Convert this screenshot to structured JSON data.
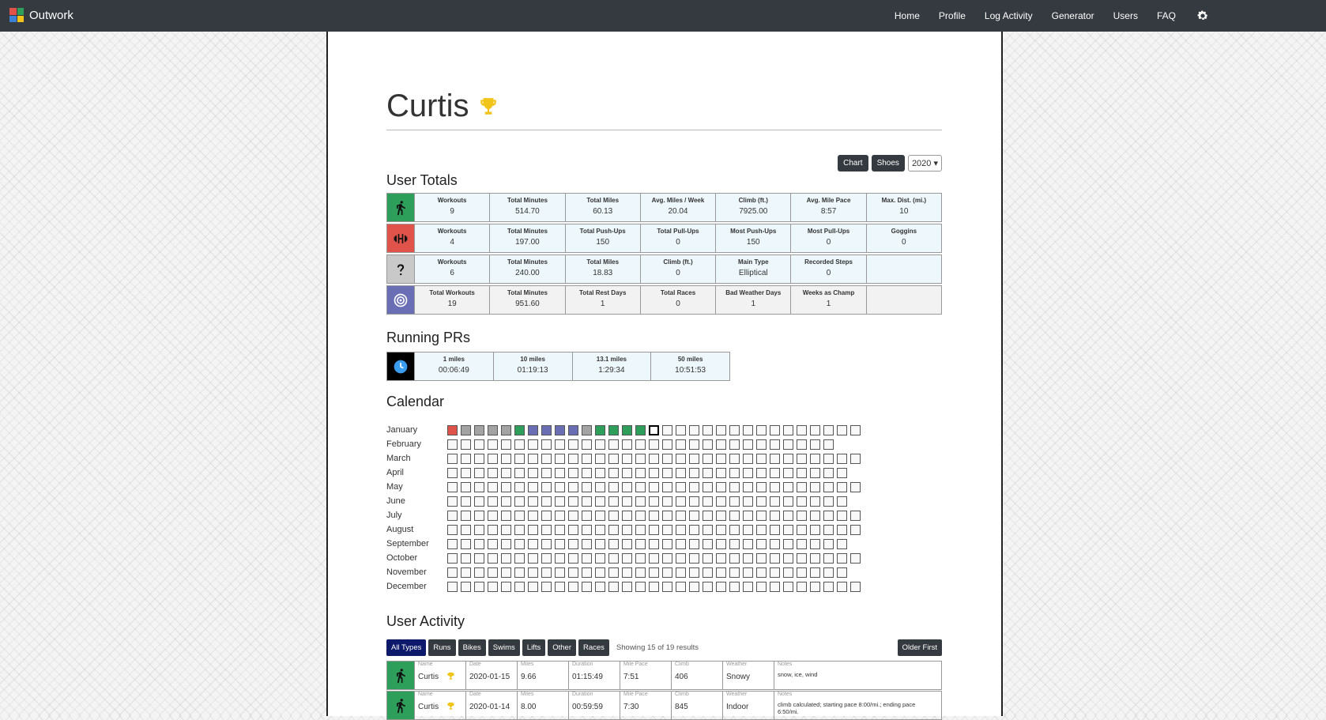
{
  "nav": {
    "brand": "Outwork",
    "links": [
      "Home",
      "Profile",
      "Log Activity",
      "Generator",
      "Users",
      "FAQ"
    ],
    "settings_icon": "gear-icon"
  },
  "profile": {
    "name": "Curtis",
    "badge_icon": "trophy-icon"
  },
  "controls": {
    "chart": "Chart",
    "shoes": "Shoes",
    "year": "2020"
  },
  "sections": {
    "totals": "User Totals",
    "prs": "Running PRs",
    "calendar": "Calendar",
    "activity": "User Activity"
  },
  "colors": {
    "run": "#2e9e5b",
    "lift": "#e0534a",
    "other": "#c9c9c9",
    "total": "#6a6fb5",
    "pr": "#000000",
    "day_empty": "#f8f8f8",
    "day_other": "#a3a3a3",
    "nav": "#343a40"
  },
  "totals": [
    {
      "icon": "running-icon",
      "cells": [
        {
          "label": "Workouts",
          "value": "9"
        },
        {
          "label": "Total Minutes",
          "value": "514.70"
        },
        {
          "label": "Total Miles",
          "value": "60.13"
        },
        {
          "label": "Avg. Miles / Week",
          "value": "20.04"
        },
        {
          "label": "Climb (ft.)",
          "value": "7925.00"
        },
        {
          "label": "Avg. Mile Pace",
          "value": "8:57"
        },
        {
          "label": "Max. Dist. (mi.)",
          "value": "10"
        }
      ]
    },
    {
      "icon": "dumbbell-icon",
      "cells": [
        {
          "label": "Workouts",
          "value": "4"
        },
        {
          "label": "Total Minutes",
          "value": "197.00"
        },
        {
          "label": "Total Push-Ups",
          "value": "150"
        },
        {
          "label": "Total Pull-Ups",
          "value": "0"
        },
        {
          "label": "Most Push-Ups",
          "value": "150"
        },
        {
          "label": "Most Pull-Ups",
          "value": "0"
        },
        {
          "label": "Goggins",
          "value": "0"
        }
      ]
    },
    {
      "icon": "question-icon",
      "cells": [
        {
          "label": "Workouts",
          "value": "6"
        },
        {
          "label": "Total Minutes",
          "value": "240.00"
        },
        {
          "label": "Total Miles",
          "value": "18.83"
        },
        {
          "label": "Climb (ft.)",
          "value": "0"
        },
        {
          "label": "Main Type",
          "value": "Elliptical"
        },
        {
          "label": "Recorded Steps",
          "value": "0"
        },
        {
          "label": "",
          "value": ""
        }
      ]
    },
    {
      "icon": "target-icon",
      "cells": [
        {
          "label": "Total Workouts",
          "value": "19"
        },
        {
          "label": "Total Minutes",
          "value": "951.60"
        },
        {
          "label": "Total Rest Days",
          "value": "1"
        },
        {
          "label": "Total Races",
          "value": "0"
        },
        {
          "label": "Bad Weather Days",
          "value": "1"
        },
        {
          "label": "Weeks as Champ",
          "value": "1"
        },
        {
          "label": "",
          "value": ""
        }
      ]
    }
  ],
  "prs": {
    "icon": "clock-icon",
    "cells": [
      {
        "label": "1 miles",
        "value": "00:06:49"
      },
      {
        "label": "10 miles",
        "value": "01:19:13"
      },
      {
        "label": "13.1 miles",
        "value": "1:29:34"
      },
      {
        "label": "50 miles",
        "value": "10:51:53"
      }
    ]
  },
  "calendar": {
    "months": [
      "January",
      "February",
      "March",
      "April",
      "May",
      "June",
      "July",
      "August",
      "September",
      "October",
      "November",
      "December"
    ],
    "days_in_month": [
      31,
      29,
      31,
      30,
      31,
      30,
      31,
      31,
      30,
      31,
      30,
      31
    ],
    "january_activity": [
      "lift",
      "other",
      "other",
      "other",
      "other",
      "run",
      "total",
      "total",
      "total",
      "total",
      "other",
      "run",
      "run",
      "run",
      "run",
      "today"
    ]
  },
  "activity": {
    "filters": [
      "All Types",
      "Runs",
      "Bikes",
      "Swims",
      "Lifts",
      "Other",
      "Races"
    ],
    "active_filter": "All Types",
    "showing": "Showing 15 of 19 results",
    "sort_button": "Older First",
    "columns": [
      "Name",
      "Date",
      "Miles",
      "Duration",
      "Mile Pace",
      "Climb",
      "Weather",
      "Notes"
    ],
    "rows": [
      {
        "type_icon": "running-icon",
        "name": "Curtis",
        "date": "2020-01-15",
        "miles": "9.66",
        "duration": "01:15:49",
        "pace": "7:51",
        "climb": "406",
        "weather": "Snowy",
        "notes": "snow, ice, wind"
      },
      {
        "type_icon": "running-icon",
        "name": "Curtis",
        "date": "2020-01-14",
        "miles": "8.00",
        "duration": "00:59:59",
        "pace": "7:30",
        "climb": "845",
        "weather": "Indoor",
        "notes": "climb calculated; starting pace 8:00/mi.; ending pace 6:50/mi."
      }
    ]
  }
}
